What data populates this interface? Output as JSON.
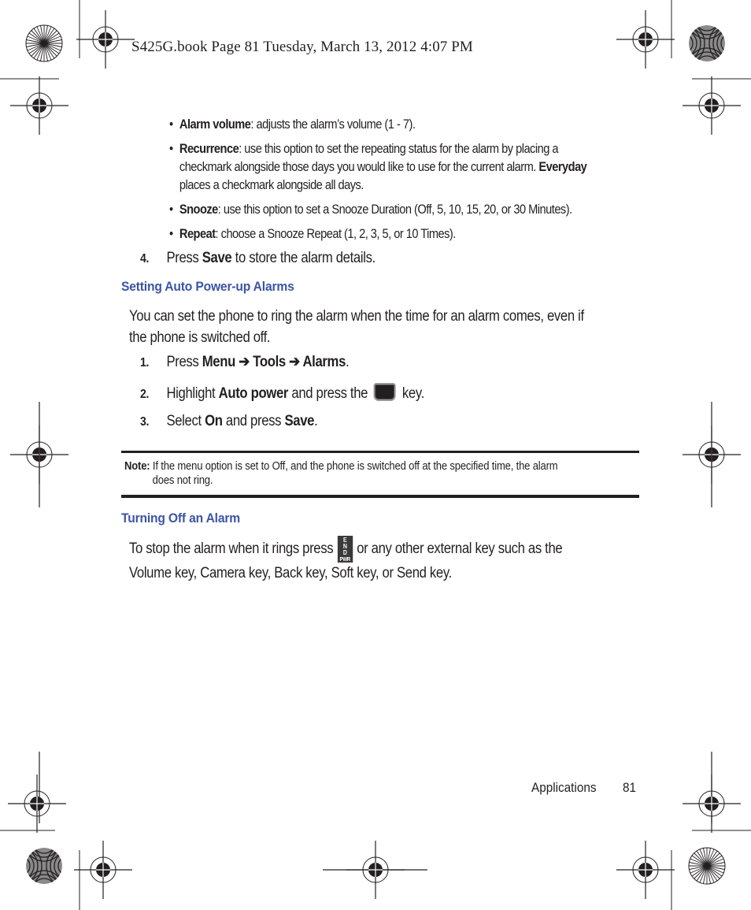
{
  "print_header": "S425G.book  Page 81  Tuesday, March 13, 2012  4:07 PM",
  "bullets": [
    {
      "term": "Alarm volume",
      "text": ": adjusts the alarm’s volume (1 - 7)."
    },
    {
      "term": "Recurrence",
      "text": ": use this option to set the repeating status for the alarm by placing a",
      "cont1": "checkmark alongside those days you would like to use for the current alarm. ",
      "cont1_bold": "Everyday",
      "cont2": "places a checkmark alongside all days."
    },
    {
      "term": "Snooze",
      "text": ": use this option to set a Snooze Duration (Off, 5, 10, 15, 20, or 30 Minutes)."
    },
    {
      "term": "Repeat",
      "text": ": choose a Snooze Repeat (1, 2, 3, 5, or 10 Times)."
    }
  ],
  "step4": {
    "num": "4.",
    "pre": "Press ",
    "bold": "Save",
    "post": " to store the alarm details."
  },
  "section1": {
    "heading": "Setting Auto Power-up Alarms",
    "intro_line1": "You can set the phone to ring the alarm when the time for an alarm comes, even if",
    "intro_line2": "the phone is switched off.",
    "steps": [
      {
        "num": "1.",
        "pre": "Press ",
        "b1": "Menu",
        "arrow1": " ➔ ",
        "b2": "Tools",
        "arrow2": " ➔ ",
        "b3": "Alarms",
        "post": "."
      },
      {
        "num": "2.",
        "pre": "Highlight ",
        "b1": "Auto power",
        "mid": " and press the ",
        "key_icon": "ok-key-icon",
        "post": " key."
      },
      {
        "num": "3.",
        "pre": "Select ",
        "b1": "On",
        "mid": " and press ",
        "b2": "Save",
        "post": "."
      }
    ]
  },
  "note": {
    "label": "Note:",
    "line1": " If the menu option is set to Off, and the phone is switched off at the specified time, the alarm",
    "line2": "does not ring."
  },
  "section2": {
    "heading": "Turning Off an Alarm",
    "line1_pre": "To stop the alarm when it rings press",
    "end_key": {
      "l1": "E",
      "l2": "N",
      "l3": "D",
      "l4": "PWR"
    },
    "line1_post": "or any other external key such as the",
    "line2": "Volume key, Camera key, Back key, Soft key, or Send key."
  },
  "footer": {
    "section": "Applications",
    "page": "81"
  },
  "colors": {
    "heading": "#3a55a4",
    "text": "#231f20"
  }
}
